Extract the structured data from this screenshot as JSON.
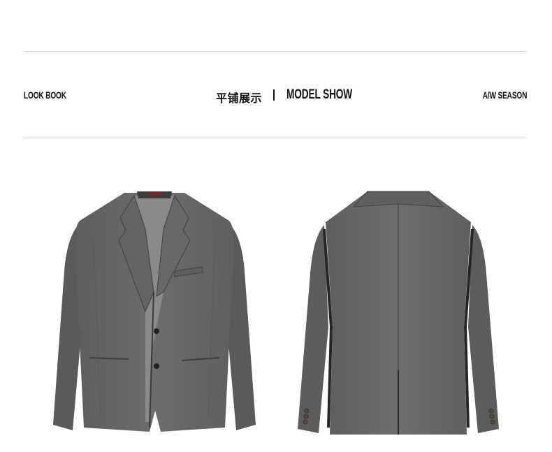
{
  "header": {
    "left_label": "LOOK BOOK",
    "title_cn": "平铺展示",
    "separator": "|",
    "title_en": "MODEL SHOW",
    "right_label": "A/W SEASON"
  },
  "colors": {
    "jacket_grey": "#6a6a6a",
    "jacket_shadow": "#3c3c3c",
    "lining_grey": "#8d8d8d",
    "rule": "#cfcfcf",
    "text": "#111111"
  },
  "images": [
    {
      "name": "jacket-front-photo",
      "view": "front"
    },
    {
      "name": "jacket-back-photo",
      "view": "back"
    }
  ]
}
